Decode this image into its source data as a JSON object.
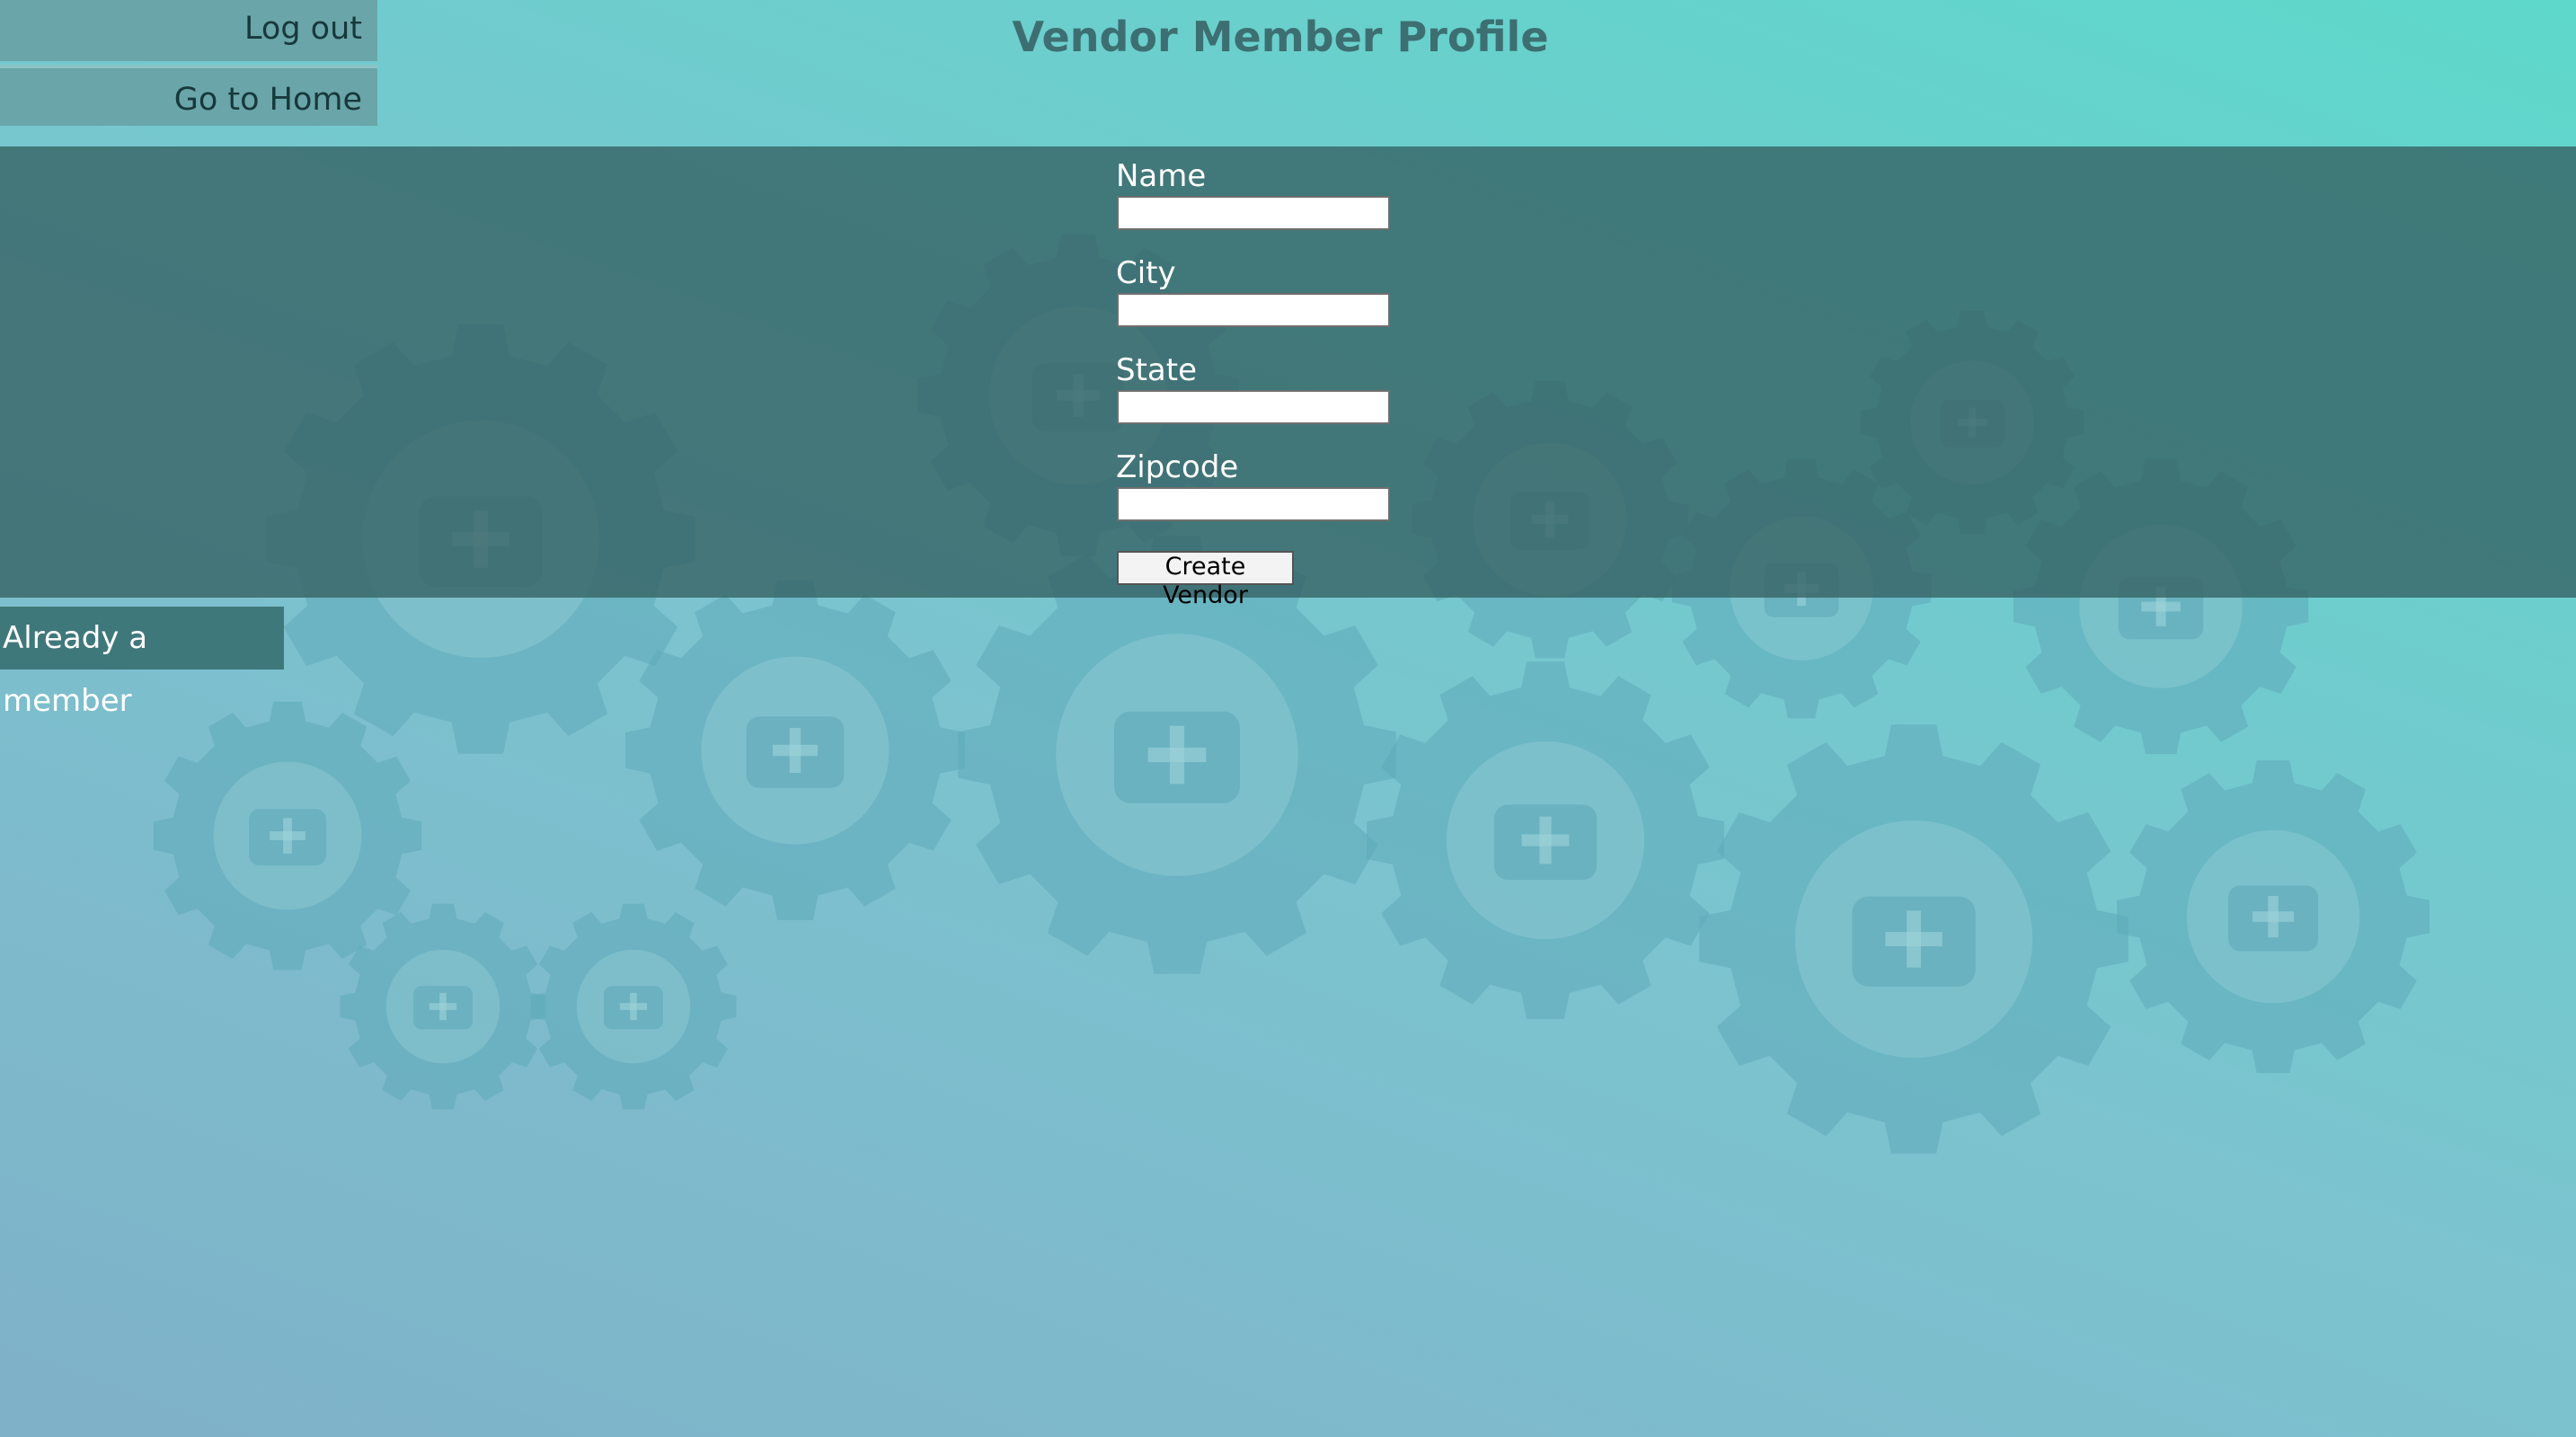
{
  "header": {
    "title": "Vendor Member Profile",
    "logout_label": "Log out",
    "home_label": "Go to Home"
  },
  "form": {
    "name_label": "Name",
    "name_value": "",
    "city_label": "City",
    "city_value": "",
    "state_label": "State",
    "state_value": "",
    "zipcode_label": "Zipcode",
    "zipcode_value": "",
    "submit_label": "Create Vendor"
  },
  "footer": {
    "member_label": "Already a member"
  },
  "colors": {
    "band": "#3a6a6c",
    "accent": "#3d6f72",
    "gear": "#5fa9b9"
  },
  "background_icons": [
    "ambulance-icon",
    "heart-icon",
    "microscope-icon",
    "thermometer-icon",
    "stethoscope-icon",
    "caduceus-icon",
    "tooth-icon",
    "clipboard-icon",
    "medical-kit-icon",
    "flask-icon",
    "pill-bottle-icon",
    "wheelchair-icon",
    "nurse-icon",
    "iv-bag-icon"
  ]
}
